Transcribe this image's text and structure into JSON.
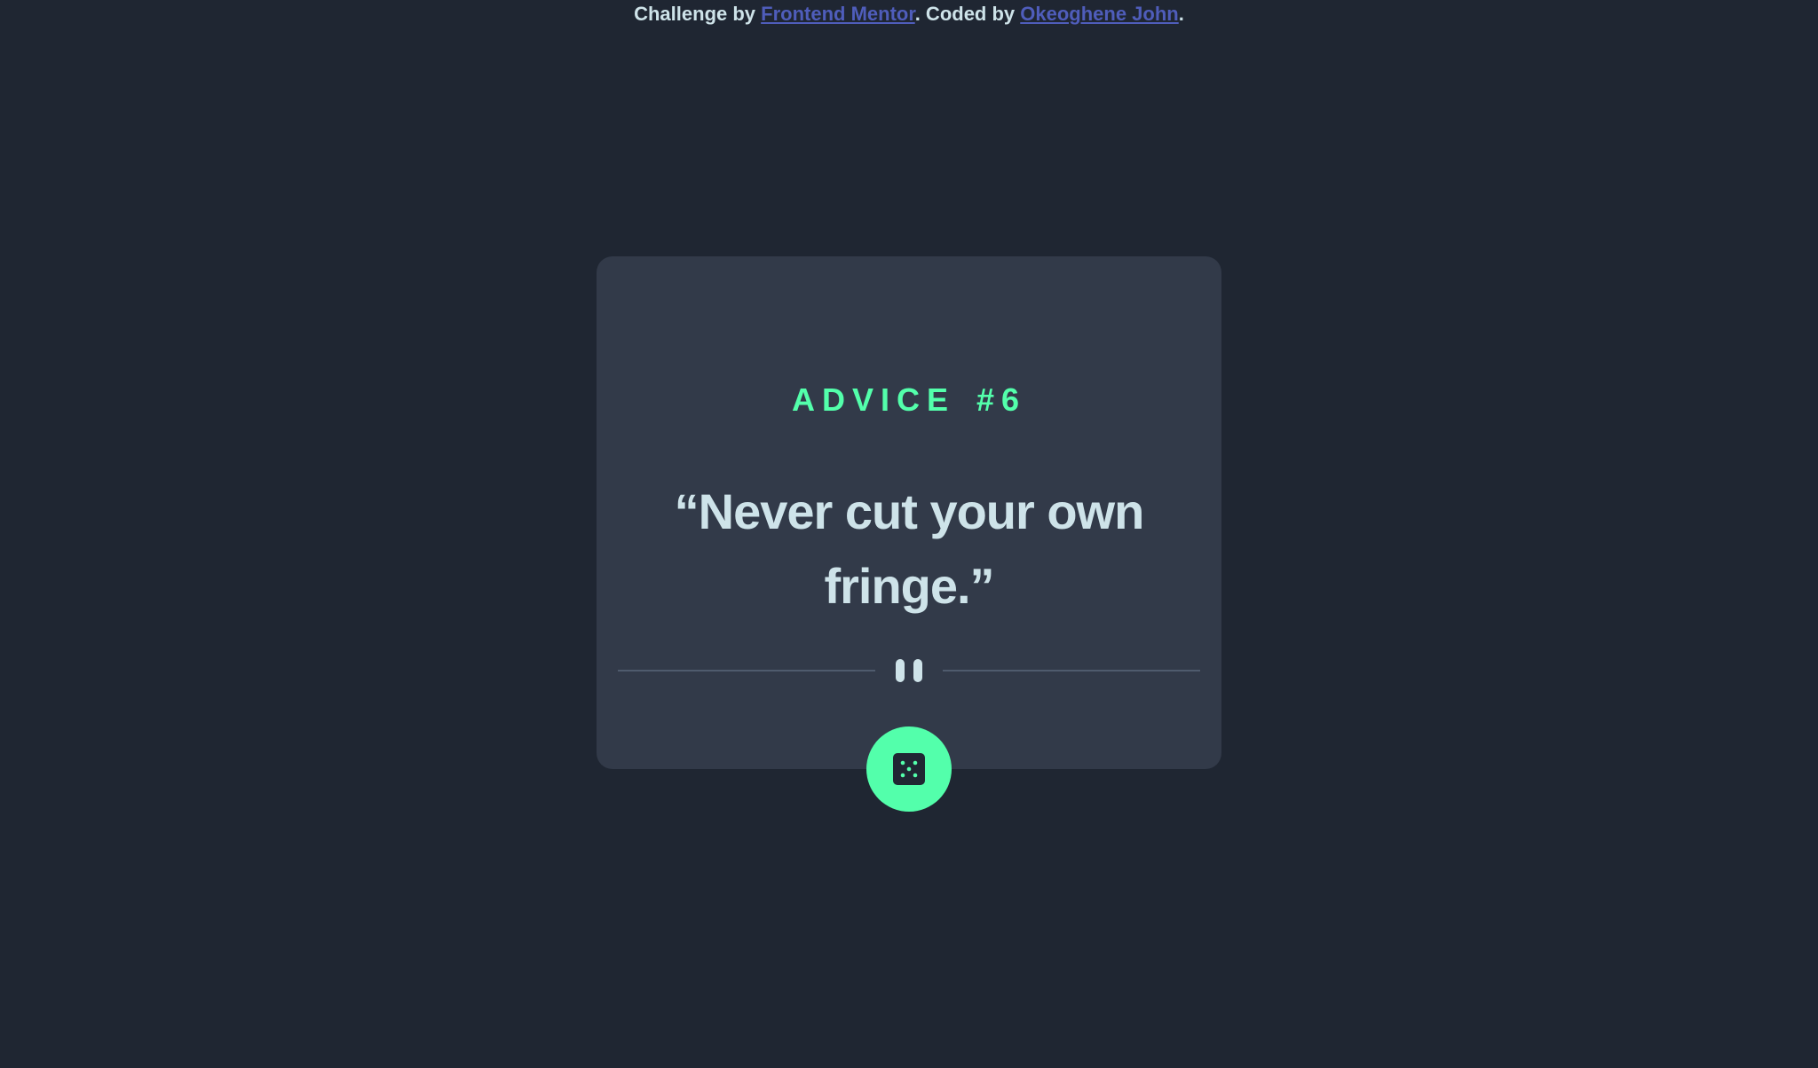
{
  "attribution": {
    "prefix": "Challenge by ",
    "challenge_link": "Frontend Mentor",
    "middle": ". Coded by ",
    "author_link": "Okeoghene John",
    "suffix": "."
  },
  "card": {
    "advice_label": "ADVICE",
    "advice_number": "#6",
    "quote": "“Never cut your own fringe.”"
  },
  "icons": {
    "divider": "pause-icon",
    "button": "dice-icon"
  },
  "colors": {
    "background": "#1f2632",
    "card": "#323a49",
    "accent": "#53ffab",
    "text": "#cee3e9",
    "link": "#4f5dbb"
  }
}
